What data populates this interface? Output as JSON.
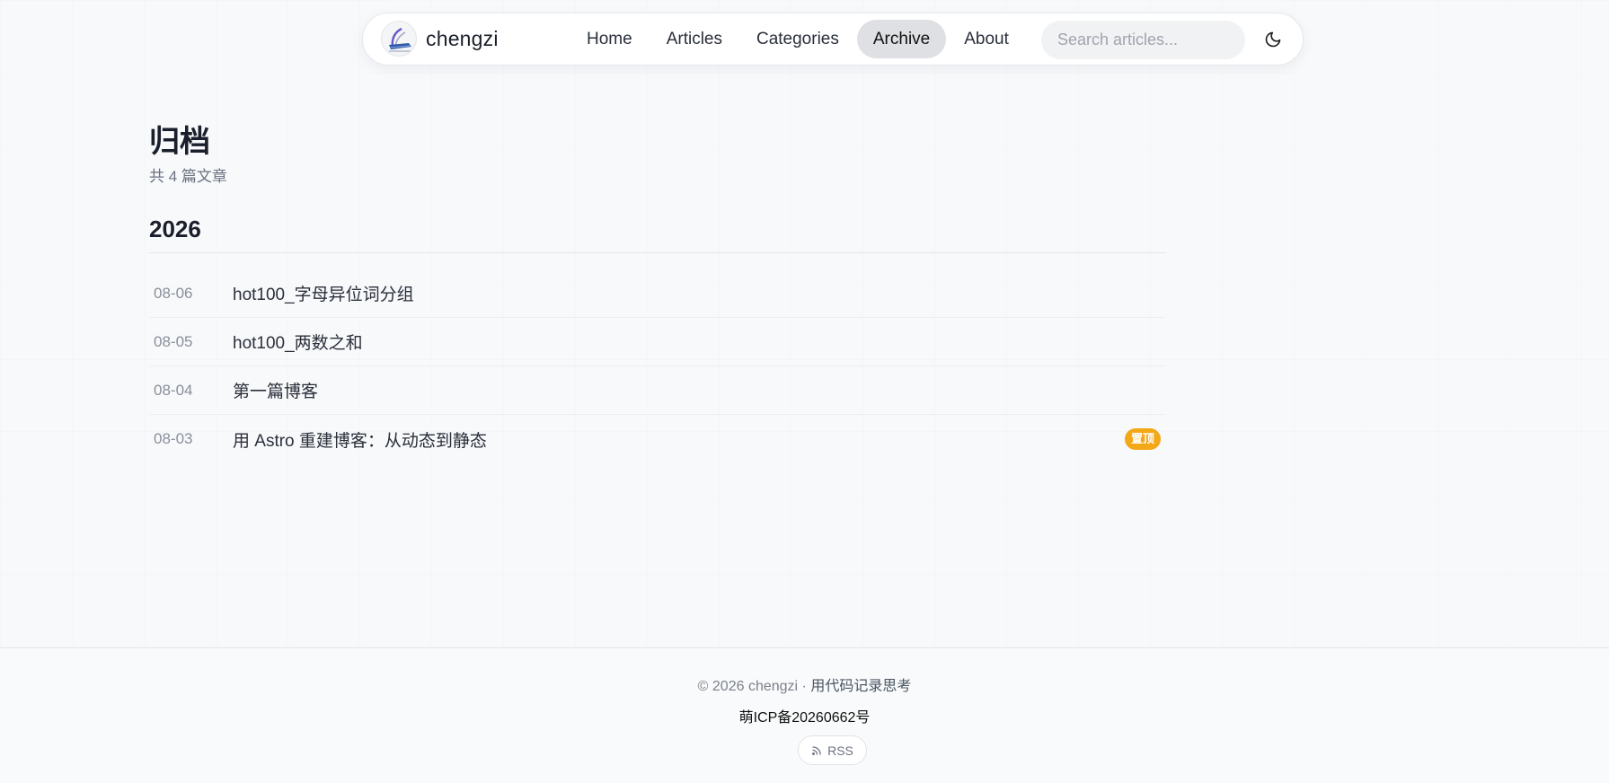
{
  "nav": {
    "brand": "chengzi",
    "links": [
      {
        "label": "Home",
        "active": false
      },
      {
        "label": "Articles",
        "active": false
      },
      {
        "label": "Categories",
        "active": false
      },
      {
        "label": "Archive",
        "active": true
      },
      {
        "label": "About",
        "active": false
      }
    ],
    "search_placeholder": "Search articles...",
    "theme_icon": "moon-icon"
  },
  "page": {
    "title": "归档",
    "subtitle": "共 4 篇文章"
  },
  "archive": {
    "year": "2026",
    "posts": [
      {
        "date": "08-06",
        "title": "hot100_字母异位词分组"
      },
      {
        "date": "08-05",
        "title": "hot100_两数之和"
      },
      {
        "date": "08-04",
        "title": "第一篇博客"
      },
      {
        "date": "08-03",
        "title": "用 Astro 重建博客：从动态到静态",
        "badge": "置顶"
      }
    ]
  },
  "footer": {
    "copyright": "© 2026 chengzi · ",
    "tagline": "用代码记录思考",
    "icp": "萌ICP备20260662号",
    "rss_label": "RSS",
    "rss_icon": "rss-icon"
  },
  "colors": {
    "pin_badge": "#f3a818",
    "active_nav": "#dfe0e3"
  }
}
